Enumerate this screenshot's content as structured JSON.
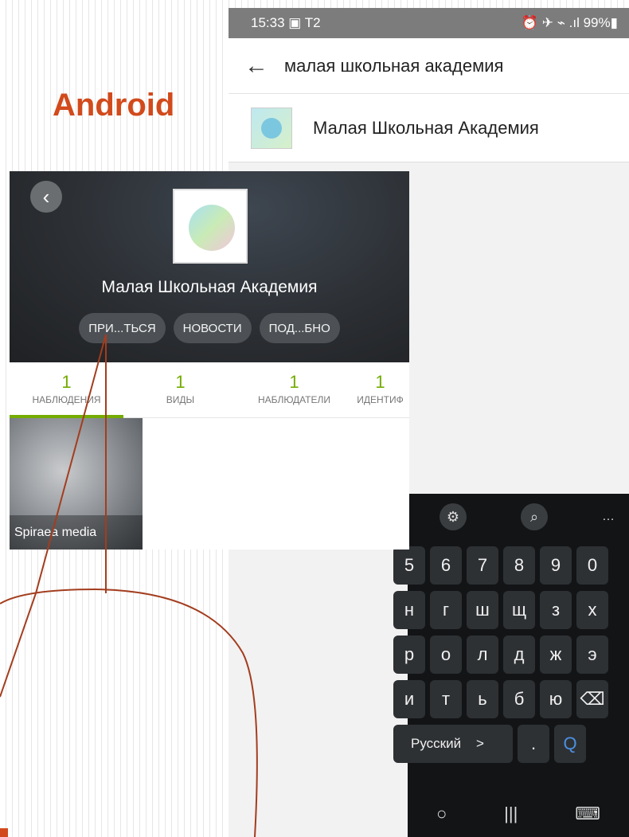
{
  "label": "Android",
  "search_screen": {
    "status_time": "15:33",
    "status_extra": "▣ T2",
    "status_right": "⏰ ✈ ⌁ .ıl 99%▮",
    "back_icon": "←",
    "query": "малая школьная академия",
    "result_label": "Малая Школьная Академия"
  },
  "keyboard": {
    "row_numbers": [
      "5",
      "6",
      "7",
      "8",
      "9",
      "0"
    ],
    "row1": [
      "н",
      "г",
      "ш",
      "щ",
      "з",
      "х"
    ],
    "row2": [
      "р",
      "о",
      "л",
      "д",
      "ж",
      "э"
    ],
    "row3": [
      "и",
      "т",
      "ь",
      "б",
      "ю",
      "⌫"
    ],
    "lang": "Русский",
    "lang_arrow": ">",
    "dot": ".",
    "search_icon": "Q",
    "nav_home": "○",
    "nav_recent": "|||",
    "nav_kb": "⌨",
    "top_gear": "⚙",
    "top_search": "⌕",
    "top_more": "…"
  },
  "project_screen": {
    "back_icon": "‹",
    "title": "Малая Школьная Академия",
    "buttons": [
      "ПРИ...ТЬСЯ",
      "НОВОСТИ",
      "ПОД...БНО"
    ],
    "tabs": [
      {
        "num": "1",
        "label": "НАБЛЮДЕНИЯ"
      },
      {
        "num": "1",
        "label": "ВИДЫ"
      },
      {
        "num": "1",
        "label": "НАБЛЮДАТЕЛИ"
      },
      {
        "num": "1",
        "label": "ИДЕНТИФ"
      }
    ],
    "observation_caption": "Spiraea media"
  },
  "colors": {
    "accent": "#74ac00",
    "annotation": "#a33d1e",
    "label": "#d24a1c"
  }
}
